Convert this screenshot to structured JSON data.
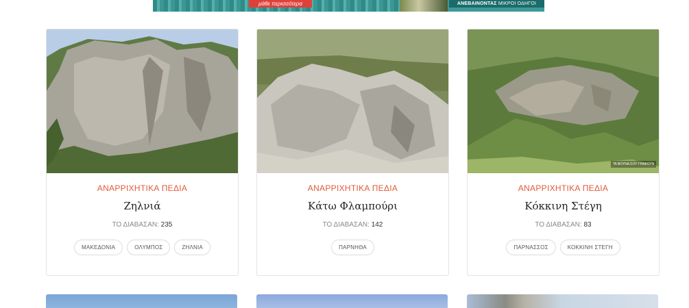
{
  "banner": {
    "cta": "μάθε περισσότερα",
    "right_main": "ΑΝΕΒΑΙΝΟΝΤΑΣ",
    "right_small": "ΜΙΚΡΟΙ ΟΔΗΓΟΙ"
  },
  "cards": [
    {
      "category": "ΑΝΑΡΡΙΧΗΤΙΚΑ ΠΕΔΙΑ",
      "title": "Ζηλνιά",
      "reads_label": "ΤΟ ΔΙΑΒΑΣΑΝ:",
      "reads": "235",
      "tags": [
        "ΜΑΚΕΔΟΝΙΑ",
        "ΟΛΥΜΠΟΣ",
        "ΖΗΛΝΙΑ"
      ]
    },
    {
      "category": "ΑΝΑΡΡΙΧΗΤΙΚΑ ΠΕΔΙΑ",
      "title": "Κάτω Φλαμπούρι",
      "reads_label": "ΤΟ ΔΙΑΒΑΣΑΝ:",
      "reads": "142",
      "tags": [
        "ΠΑΡΝΗΘΑ"
      ]
    },
    {
      "category": "ΑΝΑΡΡΙΧΗΤΙΚΑ ΠΕΔΙΑ",
      "title": "Κόκκινη Στέγη",
      "reads_label": "ΤΟ ΔΙΑΒΑΣΑΝ:",
      "reads": "83",
      "tags": [
        "ΠΑΡΝΑΣΣΟΣ",
        "ΚΟΚΚΙΝΗ ΣΤΕΓΗ"
      ],
      "image_watermark": "ΤΑ ΒΟΥΝΑ ΣΟΥ ΓΡΑΦΟΥΝ"
    }
  ]
}
